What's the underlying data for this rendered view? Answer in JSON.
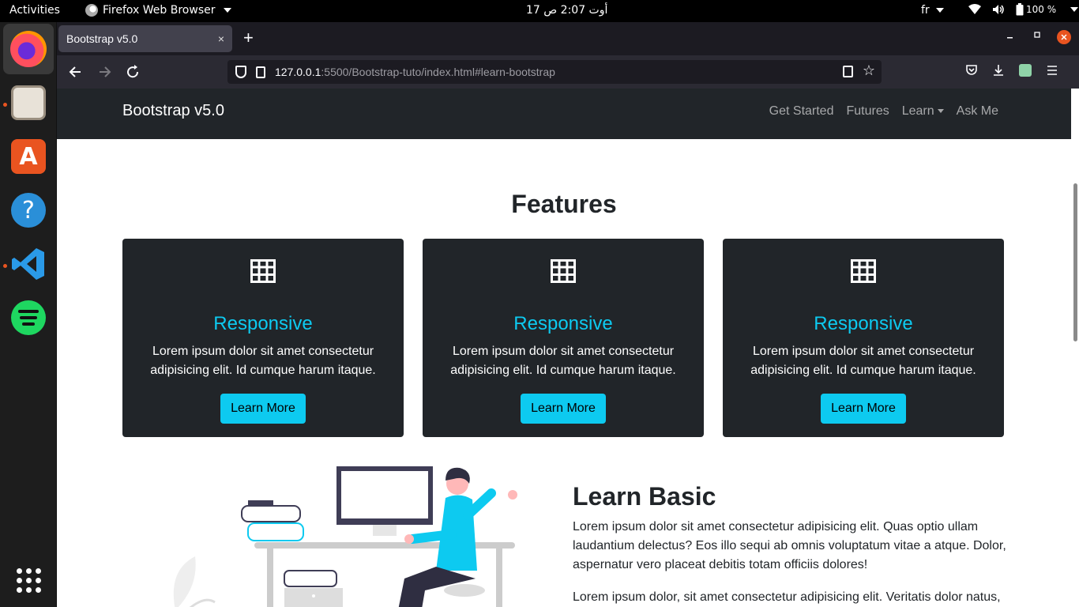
{
  "topbar": {
    "activities": "Activities",
    "app_name": "Firefox Web Browser",
    "clock": "17 أوت  2:07 ص",
    "language": "fr",
    "battery": "100 %"
  },
  "dock": {
    "apps": [
      "firefox-icon",
      "files-icon",
      "software-store-icon",
      "help-icon",
      "vscode-icon",
      "spotify-icon",
      "show-apps-icon"
    ]
  },
  "browser": {
    "tab_title": "Bootstrap v5.0",
    "tab_close": "×",
    "new_tab": "+",
    "url_host": "127.0.0.1",
    "url_rest": ":5500/Bootstrap-tuto/index.html#learn-bootstrap"
  },
  "site": {
    "brand": "Bootstrap v5.0",
    "nav": [
      "Get Started",
      "Futures",
      "Learn",
      "Ask Me"
    ],
    "features_title": "Features",
    "cards": [
      {
        "title": "Responsive",
        "text": "Lorem ipsum dolor sit amet consectetur adipisicing elit. Id cumque harum itaque.",
        "button": "Learn More"
      },
      {
        "title": "Responsive",
        "text": "Lorem ipsum dolor sit amet consectetur adipisicing elit. Id cumque harum itaque.",
        "button": "Learn More"
      },
      {
        "title": "Responsive",
        "text": "Lorem ipsum dolor sit amet consectetur adipisicing elit. Id cumque harum itaque.",
        "button": "Learn More"
      }
    ],
    "learn_title": "Learn Basic",
    "learn_p1": "Lorem ipsum dolor sit amet consectetur adipisicing elit. Quas optio ullam laudantium delectus? Eos illo sequi ab omnis voluptatum vitae a atque. Dolor, aspernatur vero placeat debitis totam officiis dolores!",
    "learn_p2": "Lorem ipsum dolor, sit amet consectetur adipisicing elit. Veritatis dolor natus,"
  },
  "colors": {
    "accent": "#0dcaf0",
    "dark": "#212529",
    "ubuntu_orange": "#e95420"
  }
}
